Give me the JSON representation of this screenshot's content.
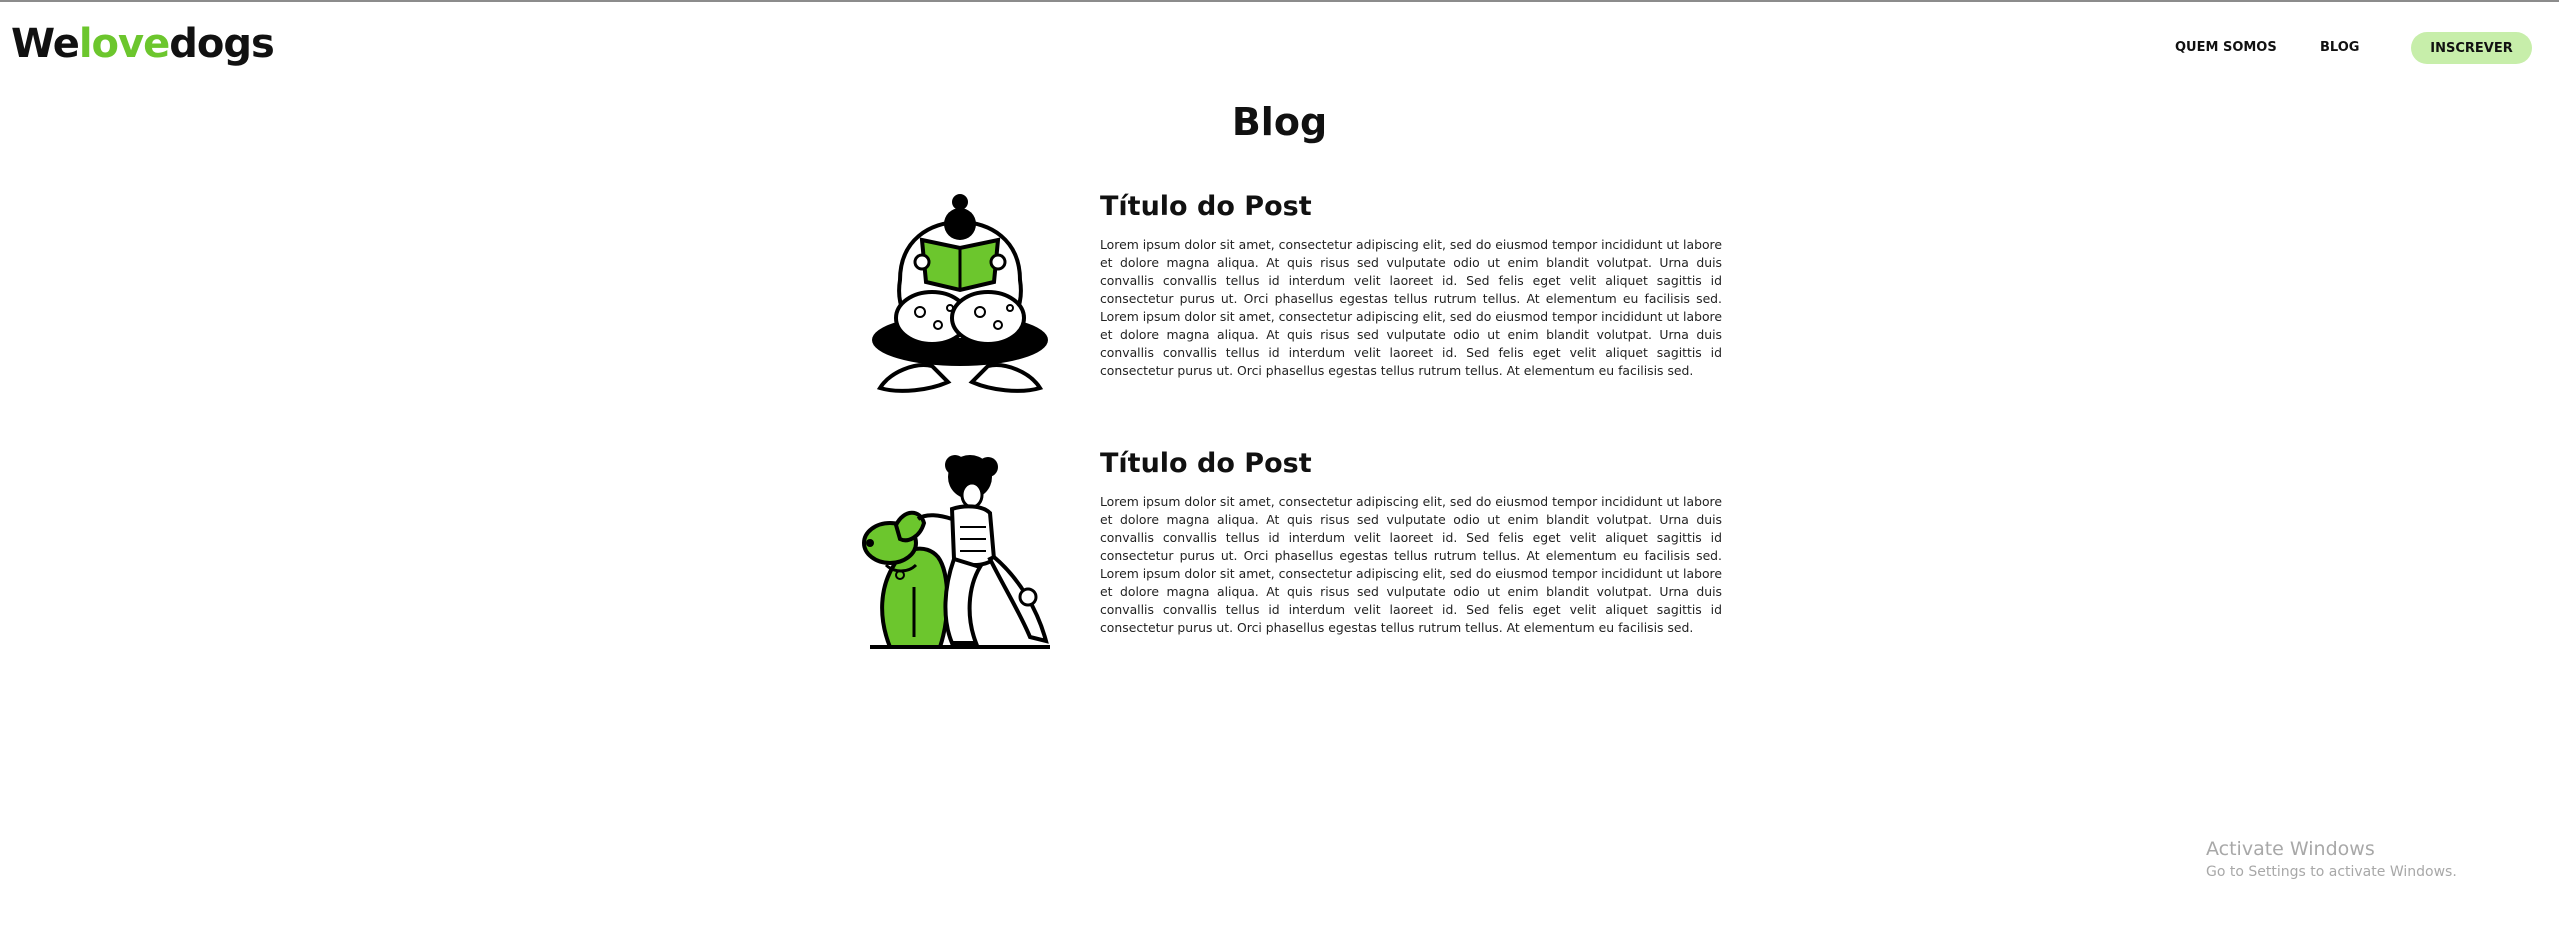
{
  "header": {
    "logo_part1": "We",
    "logo_part2": "love",
    "logo_part3": "dogs",
    "nav": {
      "about_label": "QUEM SOMOS",
      "blog_label": "BLOG",
      "subscribe_label": "INSCREVER"
    }
  },
  "main": {
    "title": "Blog",
    "posts": [
      {
        "title": "Título do Post",
        "image_icon": "person-reading-book-illustration",
        "text": "Lorem ipsum dolor sit amet, consectetur adipiscing elit, sed do eiusmod tempor incididunt ut labore et dolore magna aliqua. At quis risus sed vulputate odio ut enim blandit volutpat. Urna duis convallis convallis tellus id interdum velit laoreet id. Sed felis eget velit aliquet sagittis id consectetur purus ut. Orci phasellus egestas tellus rutrum tellus. At elementum eu facilisis sed. Lorem ipsum dolor sit amet, consectetur adipiscing elit, sed do eiusmod tempor incididunt ut labore et dolore magna aliqua. At quis risus sed vulputate odio ut enim blandit volutpat. Urna duis convallis convallis tellus id interdum velit laoreet id. Sed felis eget velit aliquet sagittis id consectetur purus ut. Orci phasellus egestas tellus rutrum tellus. At elementum eu facilisis sed."
      },
      {
        "title": "Título do Post",
        "image_icon": "person-with-dog-illustration",
        "text": "Lorem ipsum dolor sit amet, consectetur adipiscing elit, sed do eiusmod tempor incididunt ut labore et dolore magna aliqua. At quis risus sed vulputate odio ut enim blandit volutpat. Urna duis convallis convallis tellus id interdum velit laoreet id. Sed felis eget velit aliquet sagittis id consectetur purus ut. Orci phasellus egestas tellus rutrum tellus. At elementum eu facilisis sed. Lorem ipsum dolor sit amet, consectetur adipiscing elit, sed do eiusmod tempor incididunt ut labore et dolore magna aliqua. At quis risus sed vulputate odio ut enim blandit volutpat. Urna duis convallis convallis tellus id interdum velit laoreet id. Sed felis eget velit aliquet sagittis id consectetur purus ut. Orci phasellus egestas tellus rutrum tellus. At elementum eu facilisis sed."
      }
    ]
  },
  "watermark": {
    "line1": "Activate Windows",
    "line2": "Go to Settings to activate Windows."
  },
  "colors": {
    "accent": "#6cc62d",
    "subscribe_bg": "#c7eeaa",
    "text": "#111111"
  }
}
